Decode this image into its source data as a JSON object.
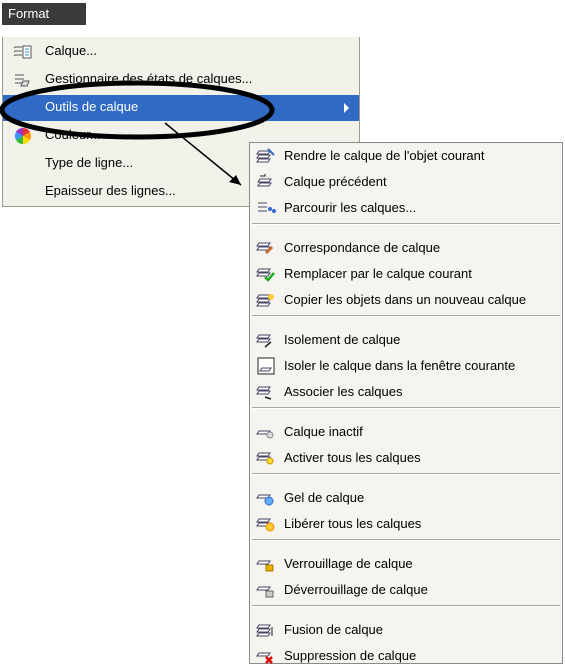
{
  "menubar": {
    "format_label": "Format"
  },
  "main_menu": {
    "items": [
      {
        "label": "Calque...",
        "icon": "layer-properties-icon"
      },
      {
        "label": "Gestionnaire des états de calques...",
        "icon": "layer-states-icon"
      },
      {
        "label": "Outils de calque",
        "icon": "",
        "highlighted": true,
        "has_submenu": true
      },
      {
        "label": "Couleur...",
        "icon": "color-wheel-icon"
      },
      {
        "label": "Type de ligne...",
        "icon": ""
      },
      {
        "label": "Epaisseur des lignes...",
        "icon": ""
      }
    ]
  },
  "submenu": {
    "items": [
      {
        "label": "Rendre le calque de l'objet courant",
        "icon": "make-object-layer-current-icon"
      },
      {
        "label": "Calque précédent",
        "icon": "layer-previous-icon"
      },
      {
        "label": "Parcourir les calques...",
        "icon": "layer-walk-icon"
      },
      {
        "label": "Correspondance de calque",
        "icon": "layer-match-icon"
      },
      {
        "label": "Remplacer par le calque courant",
        "icon": "change-to-current-layer-icon"
      },
      {
        "label": "Copier les objets dans un nouveau calque",
        "icon": "copy-objects-to-new-layer-icon"
      },
      {
        "label": "Isolement de calque",
        "icon": "layer-isolate-icon"
      },
      {
        "label": "Isoler le calque dans la fenêtre courante",
        "icon": "isolate-in-viewport-icon"
      },
      {
        "label": "Associer les calques",
        "icon": "layer-unisolate-icon"
      },
      {
        "label": "Calque inactif",
        "icon": "layer-off-icon"
      },
      {
        "label": "Activer tous les calques",
        "icon": "turn-all-layers-on-icon"
      },
      {
        "label": "Gel de calque",
        "icon": "layer-freeze-icon"
      },
      {
        "label": "Libérer tous les calques",
        "icon": "thaw-all-layers-icon"
      },
      {
        "label": "Verrouillage de calque",
        "icon": "layer-lock-icon"
      },
      {
        "label": "Déverrouillage de calque",
        "icon": "layer-unlock-icon"
      },
      {
        "label": "Fusion de calque",
        "icon": "layer-merge-icon"
      },
      {
        "label": "Suppression de calque",
        "icon": "layer-delete-icon"
      }
    ]
  },
  "colors": {
    "highlight": "#316ac5",
    "menu_bg": "#f2f1ea",
    "format_tab_bg": "#3a3a3a"
  }
}
